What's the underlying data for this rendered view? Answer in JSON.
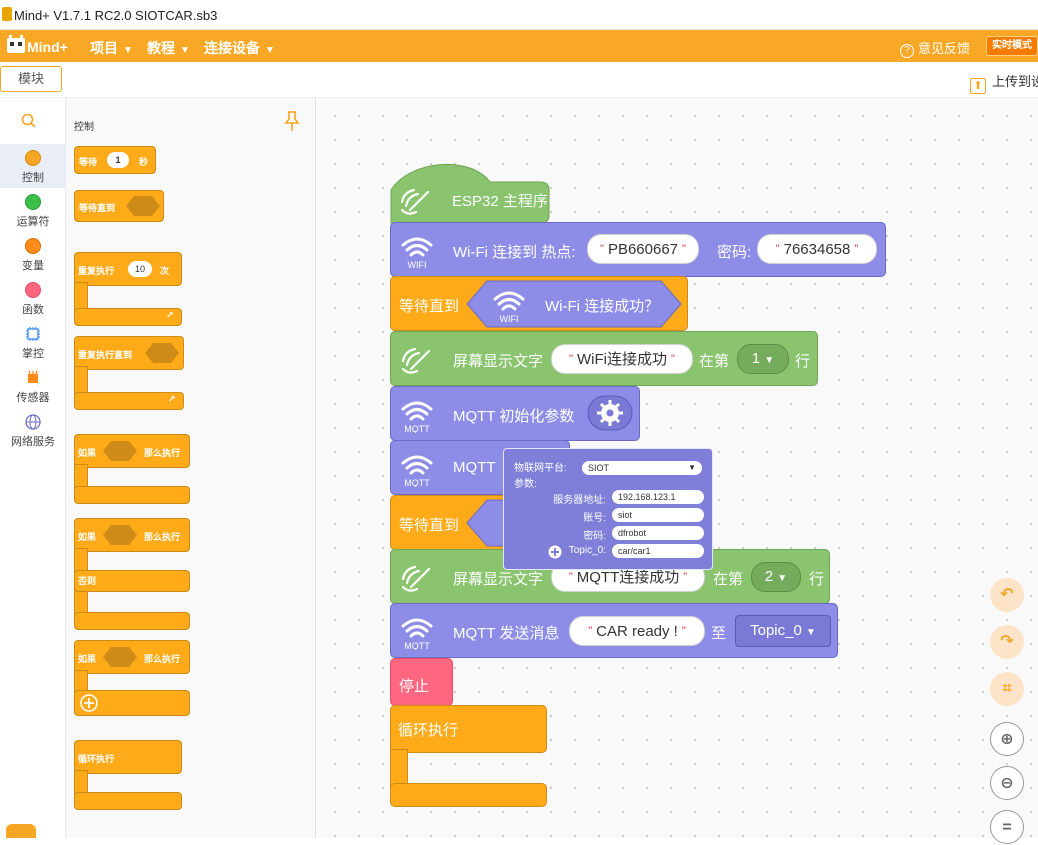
{
  "titlebar": {
    "title": "Mind+ V1.7.1 RC2.0    SIOTCAR.sb3"
  },
  "menubar": {
    "logo_text": "Mind+",
    "items": [
      {
        "label": "项目"
      },
      {
        "label": "教程"
      },
      {
        "label": "连接设备"
      }
    ],
    "feedback_label": "意见反馈",
    "mode_label": "实时模式"
  },
  "toolbar": {
    "tab_label": "模块",
    "upload_label": "上传到设"
  },
  "categories": [
    {
      "label": "控制",
      "color": "#f5a623",
      "selected": true
    },
    {
      "label": "运算符",
      "color": "#3cbf46"
    },
    {
      "label": "变量",
      "color": "#ff8c1a"
    },
    {
      "label": "函数",
      "color": "#ff6680"
    },
    {
      "label": "掌控",
      "color": "#4c97ff"
    },
    {
      "label": "传感器",
      "color": "#ff8c1a"
    },
    {
      "label": "网络服务",
      "color": "#6b6bc7"
    }
  ],
  "palette": {
    "title": "控制",
    "wait_label": "等待",
    "wait_value": "1",
    "wait_unit": "秒",
    "wait_until_label": "等待直到",
    "repeat_label": "重复执行",
    "repeat_value": "10",
    "repeat_unit": "次",
    "repeat_until_label": "重复执行直到",
    "if_label": "如果",
    "then_label": "那么执行",
    "else_label": "否则",
    "forever_label": "循环执行"
  },
  "script": {
    "hat_label": "ESP32 主程序",
    "wifi_icon_label": "WIFI",
    "wifi_connect_label": "Wi-Fi 连接到 热点:",
    "ssid": "PB660667",
    "password_label": "密码:",
    "password": "76634658",
    "wait_until_label": "等待直到",
    "wifi_connected_label": "Wi-Fi 连接成功？",
    "screen_text_label": "屏幕显示文字",
    "screen_text1": "WiFi连接成功",
    "at_row_label": "在第",
    "row1": "1",
    "row_unit": "行",
    "mqtt_icon_label": "MQTT",
    "mqtt_init_label": "MQTT 初始化参数",
    "mqtt_label": "MQTT",
    "screen_text2": "MQTT连接成功",
    "row2": "2",
    "mqtt_send_label": "MQTT 发送消息",
    "message": "CAR ready !",
    "to_label": "至",
    "topic": "Topic_0",
    "stop_label": "停止",
    "forever_label": "循环执行"
  },
  "popup": {
    "platform_label": "物联网平台:",
    "platform_value": "SIOT",
    "params_label": "参数:",
    "server_label": "服务器地址:",
    "server_value": "192.168.123.1",
    "account_label": "账号:",
    "account_value": "siot",
    "pw_label": "密码:",
    "pw_value": "dfrobot",
    "topic_label": "Topic_0:",
    "topic_value": "car/car1"
  }
}
